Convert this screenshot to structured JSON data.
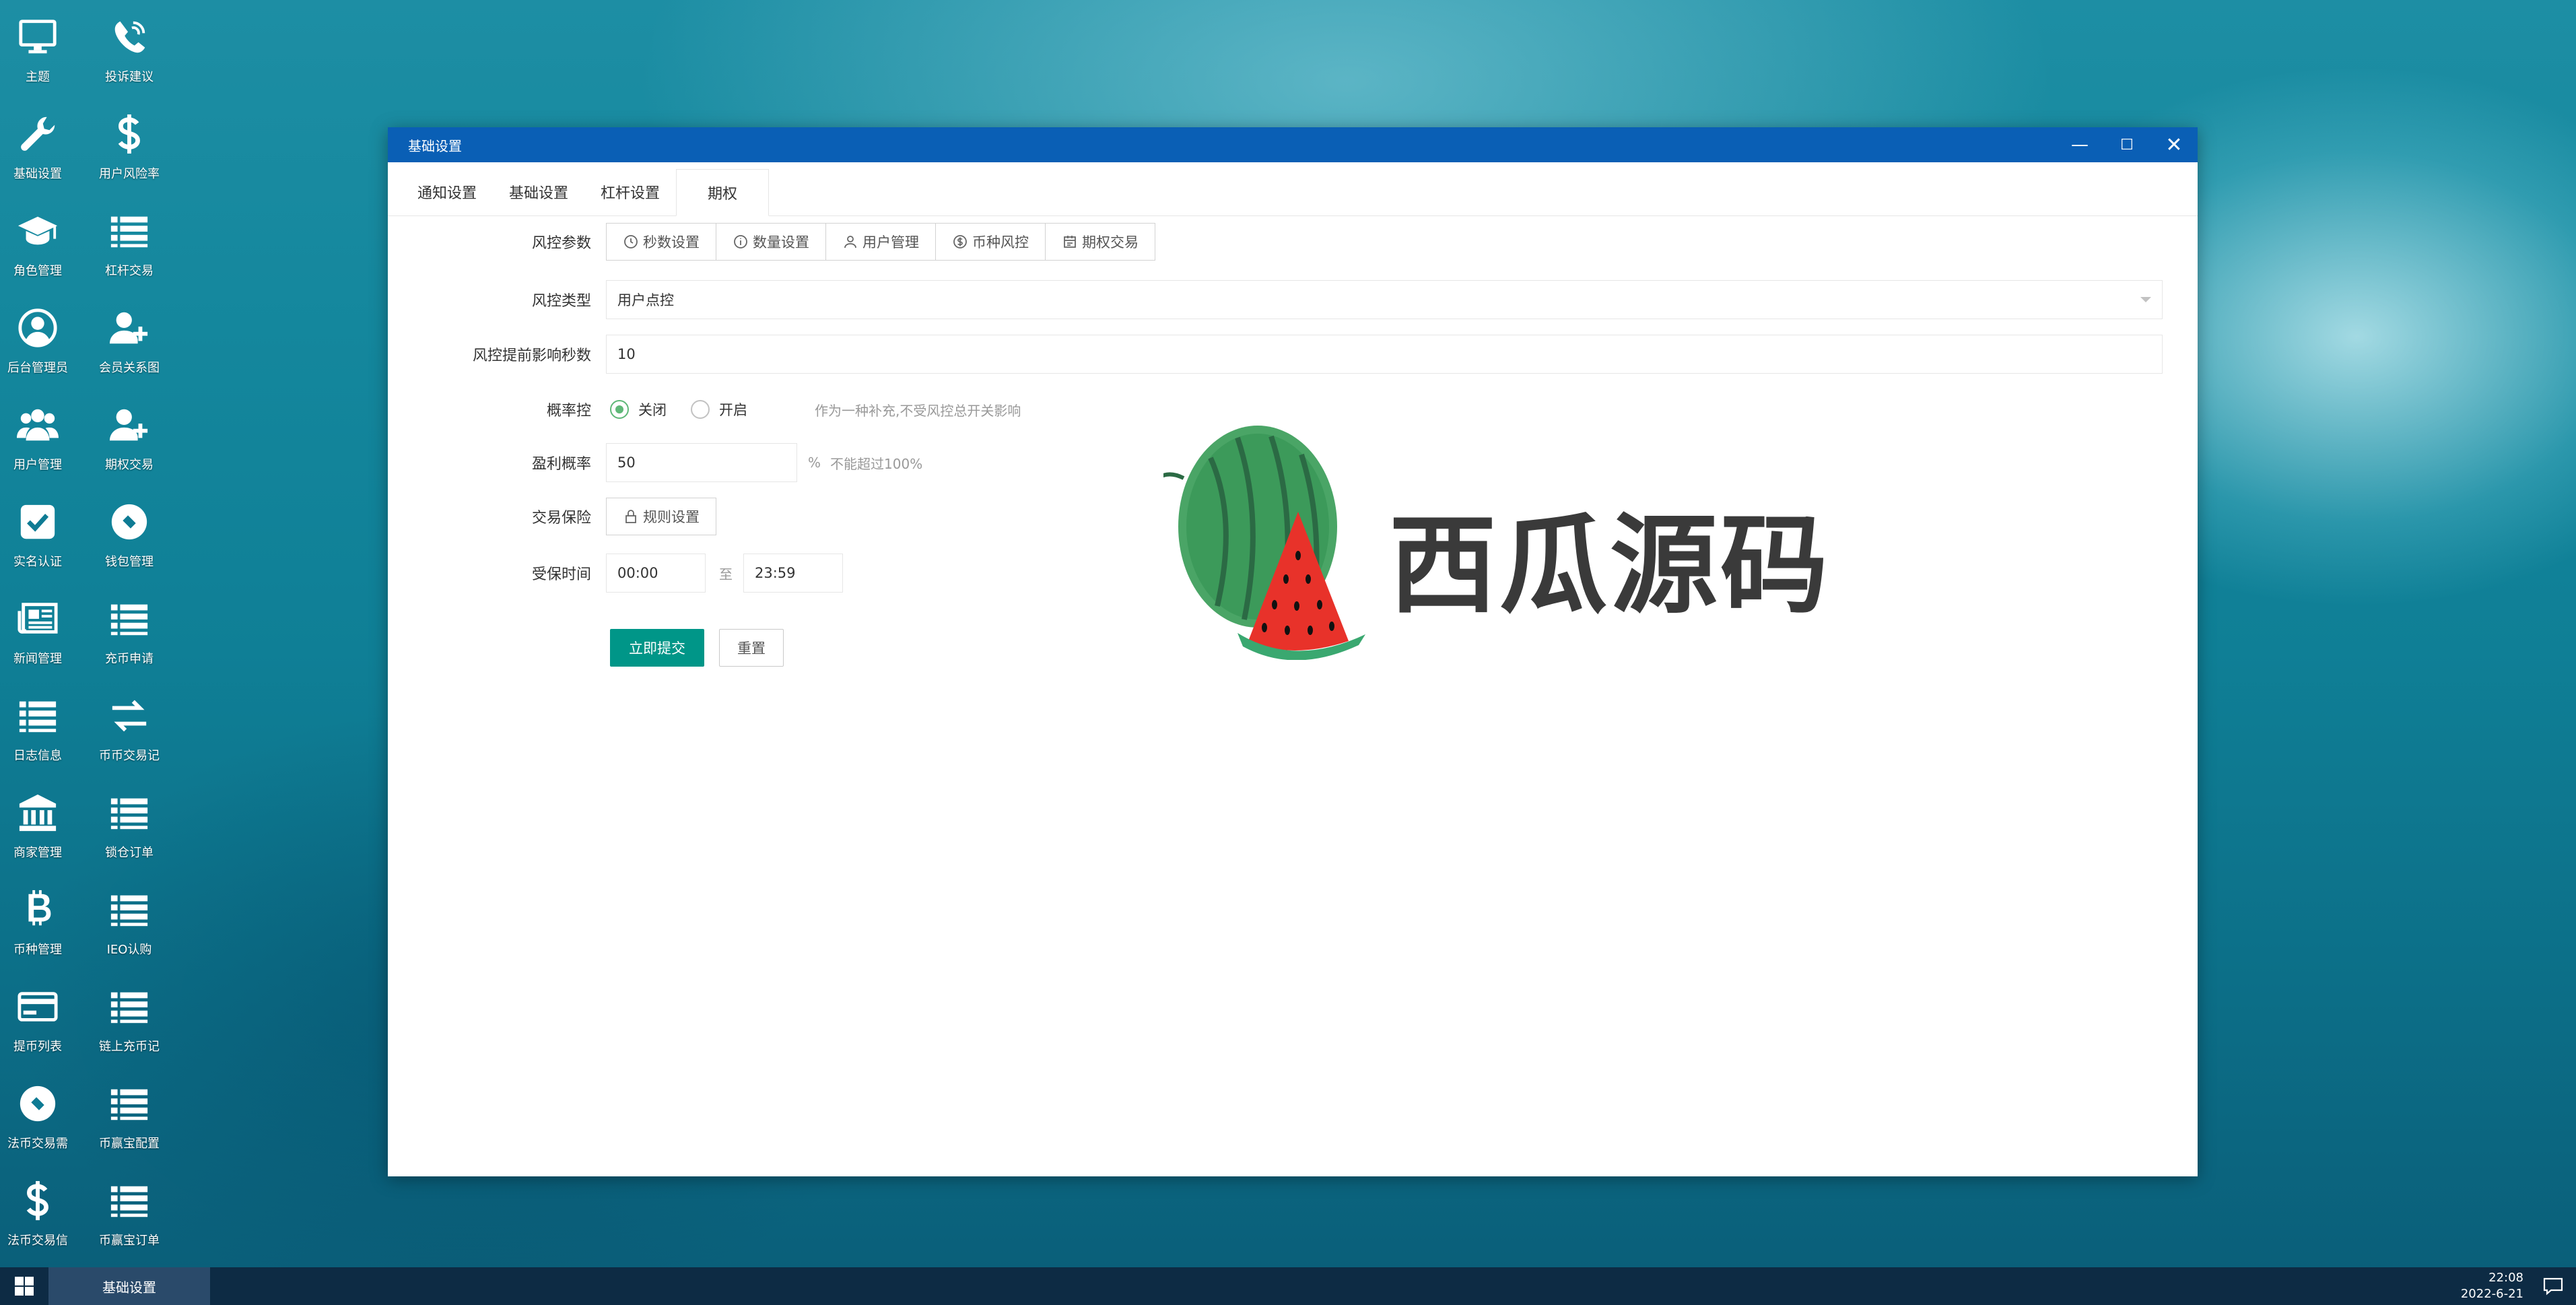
{
  "desktop": {
    "icons": [
      {
        "label": "主题",
        "icon": "monitor-icon"
      },
      {
        "label": "投诉建议",
        "icon": "phone-icon"
      },
      {
        "label": "基础设置",
        "icon": "wrench-icon"
      },
      {
        "label": "用户风险率",
        "icon": "dollar-icon"
      },
      {
        "label": "角色管理",
        "icon": "graduation-cap-icon"
      },
      {
        "label": "杠杆交易",
        "icon": "list-icon"
      },
      {
        "label": "后台管理员",
        "icon": "user-circle-icon"
      },
      {
        "label": "会员关系图",
        "icon": "user-plus-icon"
      },
      {
        "label": "用户管理",
        "icon": "users-icon"
      },
      {
        "label": "期权交易",
        "icon": "user-plus-icon"
      },
      {
        "label": "实名认证",
        "icon": "check-square-icon"
      },
      {
        "label": "钱包管理",
        "icon": "coin-icon"
      },
      {
        "label": "新闻管理",
        "icon": "newspaper-icon"
      },
      {
        "label": "充币申请",
        "icon": "list-icon"
      },
      {
        "label": "日志信息",
        "icon": "list-icon"
      },
      {
        "label": "币币交易记",
        "icon": "exchange-icon"
      },
      {
        "label": "商家管理",
        "icon": "bank-icon"
      },
      {
        "label": "锁仓订单",
        "icon": "list-icon"
      },
      {
        "label": "币种管理",
        "icon": "bitcoin-icon"
      },
      {
        "label": "IEO认购",
        "icon": "list-icon"
      },
      {
        "label": "提币列表",
        "icon": "credit-card-icon"
      },
      {
        "label": "链上充币记",
        "icon": "list-icon"
      },
      {
        "label": "法币交易需",
        "icon": "coin-icon"
      },
      {
        "label": "币赢宝配置",
        "icon": "list-icon"
      },
      {
        "label": "法币交易信",
        "icon": "dollar-icon"
      },
      {
        "label": "币赢宝订单",
        "icon": "list-icon"
      }
    ]
  },
  "window": {
    "title": "基础设置",
    "controls": {
      "minimize": "—",
      "maximize": "☐",
      "close": "✕"
    },
    "tabs": [
      "通知设置",
      "基础设置",
      "杠杆设置",
      "期权"
    ],
    "active_tab": "期权"
  },
  "form": {
    "risk_params_label": "风控参数",
    "risk_buttons": [
      {
        "label": "秒数设置",
        "icon": "clock-icon"
      },
      {
        "label": "数量设置",
        "icon": "info-icon"
      },
      {
        "label": "用户管理",
        "icon": "user-icon"
      },
      {
        "label": "币种风控",
        "icon": "dollar-circle-icon"
      },
      {
        "label": "期权交易",
        "icon": "calendar-icon"
      }
    ],
    "risk_type_label": "风控类型",
    "risk_type_value": "用户点控",
    "advance_seconds_label": "风控提前影响秒数",
    "advance_seconds_value": "10",
    "prob_control_label": "概率控",
    "prob_options": [
      {
        "label": "关闭",
        "selected": true
      },
      {
        "label": "开启",
        "selected": false
      }
    ],
    "prob_hint": "作为一种补充,不受风控总开关影响",
    "profit_rate_label": "盈利概率",
    "profit_rate_value": "50",
    "profit_rate_unit": "%",
    "profit_rate_hint": "不能超过100%",
    "insurance_label": "交易保险",
    "insurance_button": "规则设置",
    "insured_time_label": "受保时间",
    "time_start": "00:00",
    "time_sep": "至",
    "time_end": "23:59",
    "submit_label": "立即提交",
    "reset_label": "重置"
  },
  "watermark": {
    "text": "西瓜源码"
  },
  "taskbar": {
    "active_item": "基础设置",
    "time": "22:08",
    "date": "2022-6-21"
  },
  "colors": {
    "titlebar": "#0a5fb5",
    "primary_button": "#009688",
    "radio_selected": "#5fb878",
    "taskbar": "#0d2b44"
  }
}
